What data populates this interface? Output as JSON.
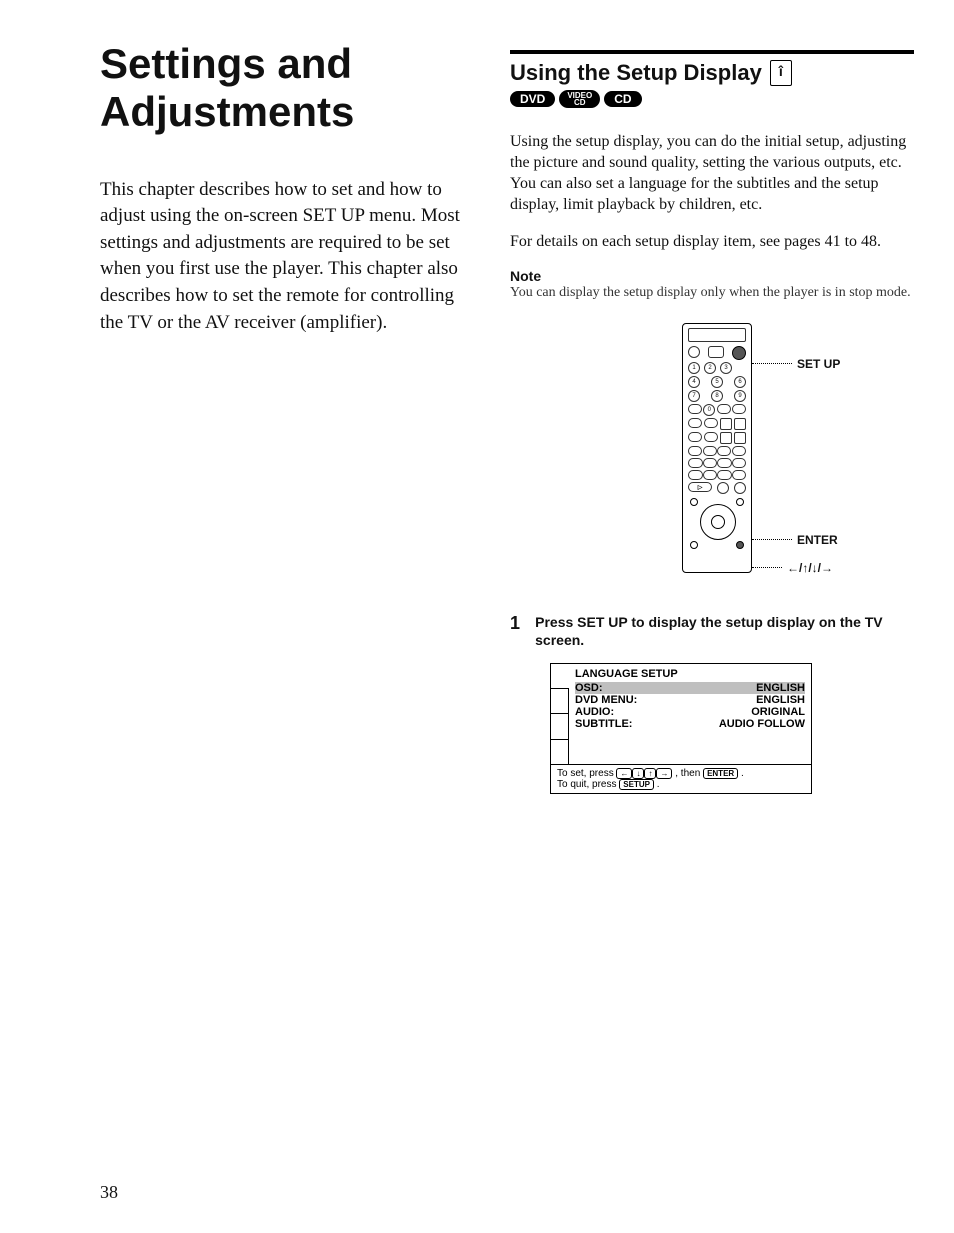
{
  "leftColumn": {
    "title": "Settings and Adjustments",
    "intro": "This chapter describes how to set and how to adjust using the on-screen SET UP menu. Most settings and adjustments are required to be set when you first use the player. This chapter also describes how to set the remote for controlling the TV or the AV receiver (amplifier)."
  },
  "rightColumn": {
    "heading": "Using the Setup Display",
    "iconGlyph": "î",
    "pills": {
      "dvd": "DVD",
      "video_top": "VIDEO",
      "video_bottom": "CD",
      "cd": "CD"
    },
    "body1": "Using the setup display, you can do the initial setup, adjusting the picture and sound quality, setting the various outputs, etc. You can also set a language for the subtitles and the setup display, limit playback by children, etc.",
    "body2": "For details on each setup display item, see pages 41 to 48.",
    "noteTitle": "Note",
    "noteBody": "You can display the setup display only when the player is in stop mode.",
    "callouts": {
      "setup": "SET UP",
      "enter": "ENTER",
      "arrows": "←/↑/↓/→"
    },
    "step": {
      "num": "1",
      "text": "Press SET UP to display the setup display on the TV screen."
    },
    "osd": {
      "title": "LANGUAGE SETUP",
      "rows": [
        {
          "label": "OSD:",
          "value": "ENGLISH",
          "selected": true
        },
        {
          "label": "DVD MENU:",
          "value": "ENGLISH",
          "selected": false
        },
        {
          "label": "AUDIO:",
          "value": "ORIGINAL",
          "selected": false
        },
        {
          "label": "SUBTITLE:",
          "value": "AUDIO FOLLOW",
          "selected": false
        }
      ],
      "footer": {
        "line1_a": "To set, press ",
        "line1_keys": [
          "←",
          "↓",
          "↑",
          "→"
        ],
        "line1_b": ", then",
        "line1_key2": "ENTER",
        "line1_c": " .",
        "line2_a": "To quit, press ",
        "line2_key": "SETUP",
        "line2_b": " ."
      }
    }
  },
  "pageNumber": "38"
}
